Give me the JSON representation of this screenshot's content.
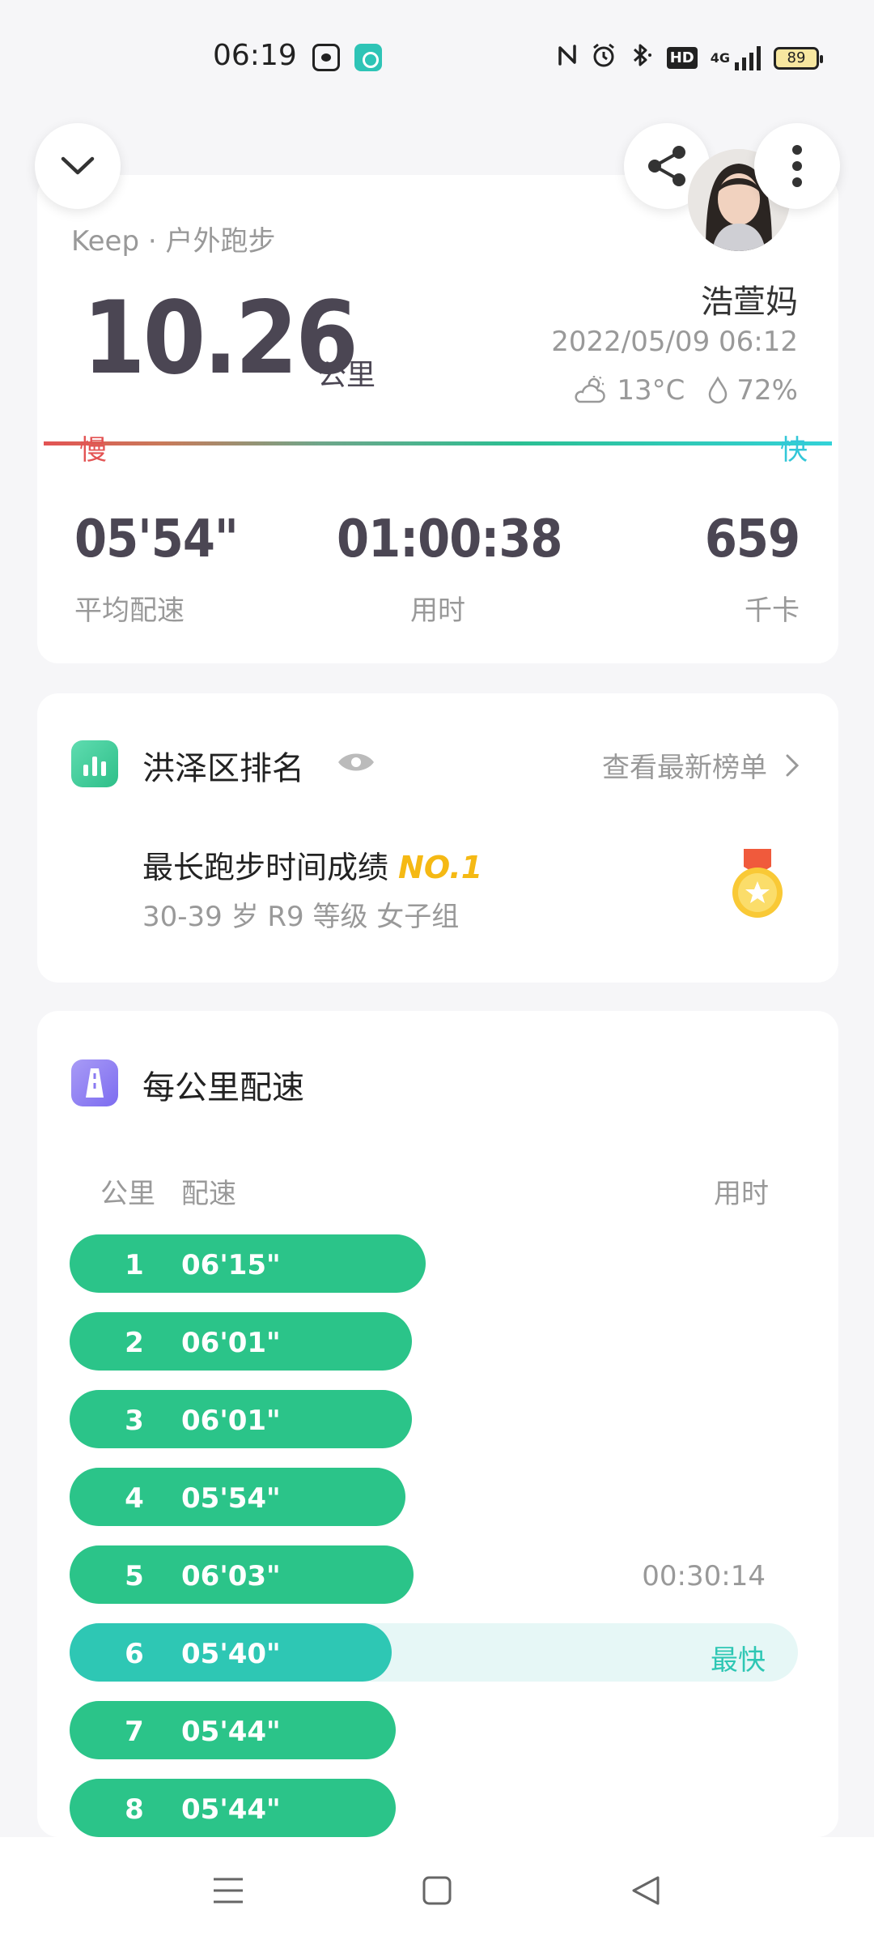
{
  "status_bar": {
    "time": "06:19",
    "hd": "HD",
    "network": "4G",
    "battery": "89"
  },
  "summary": {
    "source": "Keep · 户外跑步",
    "distance": "10.26",
    "distance_unit": "公里",
    "user_name": "浩萱妈",
    "datetime": "2022/05/09 06:12",
    "temperature": "13°C",
    "humidity": "72%",
    "slow_label": "慢",
    "fast_label": "快",
    "stats": {
      "avg_pace": "05'54\"",
      "avg_pace_label": "平均配速",
      "duration": "01:00:38",
      "duration_label": "用时",
      "calories": "659",
      "calories_label": "千卡"
    }
  },
  "ranking": {
    "title": "洪泽区排名",
    "link": "查看最新榜单",
    "achievement": "最长跑步时间成绩",
    "badge": "NO.1",
    "group": "30-39 岁 R9 等级 女子组"
  },
  "pace_section": {
    "title": "每公里配速",
    "col_km": "公里",
    "col_pace": "配速",
    "col_time": "用时",
    "rows": [
      {
        "km": "1",
        "pace": "06'15\"",
        "seconds": 375,
        "split": "",
        "fastest": false
      },
      {
        "km": "2",
        "pace": "06'01\"",
        "seconds": 361,
        "split": "",
        "fastest": false
      },
      {
        "km": "3",
        "pace": "06'01\"",
        "seconds": 361,
        "split": "",
        "fastest": false
      },
      {
        "km": "4",
        "pace": "05'54\"",
        "seconds": 354,
        "split": "",
        "fastest": false
      },
      {
        "km": "5",
        "pace": "06'03\"",
        "seconds": 363,
        "split": "00:30:14",
        "fastest": false
      },
      {
        "km": "6",
        "pace": "05'40\"",
        "seconds": 340,
        "split": "最快",
        "fastest": true
      },
      {
        "km": "7",
        "pace": "05'44\"",
        "seconds": 344,
        "split": "",
        "fastest": false
      },
      {
        "km": "8",
        "pace": "05'44\"",
        "seconds": 344,
        "split": "",
        "fastest": false
      }
    ]
  },
  "colors": {
    "accent_green": "#2bc489",
    "fastest_teal": "#2ec7b4",
    "slow_red": "#e35353",
    "fast_cyan": "#33c7d8",
    "medal_gold": "#f5b914"
  },
  "icons": {
    "collapse": "chevron-down-icon",
    "share": "share-icon",
    "more": "more-vertical-icon",
    "weather": "partly-cloudy-icon",
    "humidity": "droplet-icon",
    "rank": "bar-chart-icon",
    "visibility": "eye-icon",
    "link": "chevron-right-icon",
    "medal": "medal-icon",
    "pace": "road-icon"
  }
}
